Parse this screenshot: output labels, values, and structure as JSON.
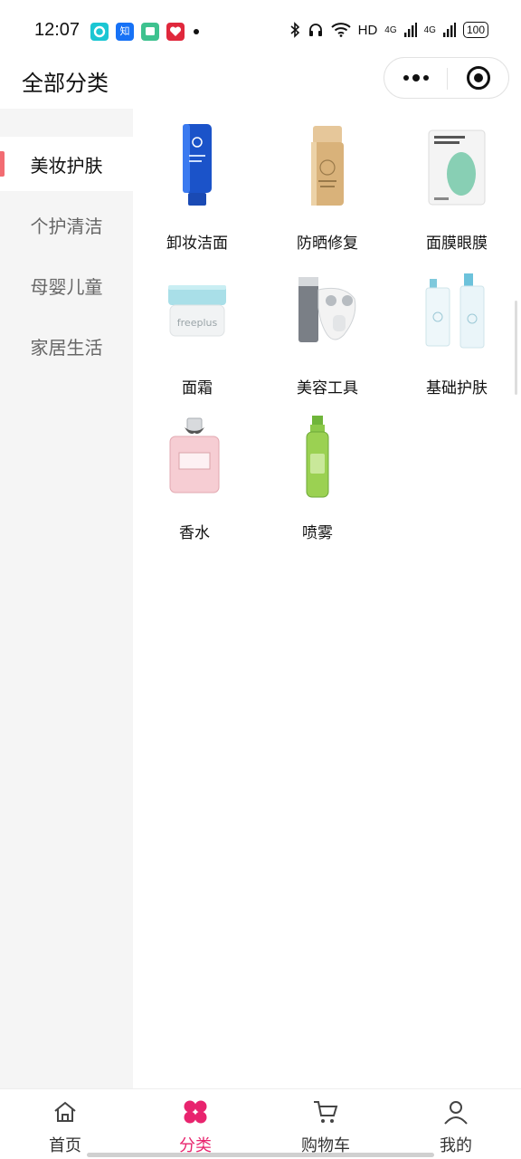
{
  "status_bar": {
    "time": "12:07",
    "network": "HD",
    "signal_1": "4G",
    "signal_2": "4G",
    "battery": "100",
    "notifications": [
      {
        "icon": "app-ring-icon",
        "text": "",
        "color": "#1bc6d3"
      },
      {
        "icon": "zhihu-icon",
        "text": "知",
        "color": "#1772f6"
      },
      {
        "icon": "message-icon",
        "text": "",
        "color": "#3ec28f"
      },
      {
        "icon": "heart-app-icon",
        "text": "",
        "color": "#e0283c"
      }
    ]
  },
  "header": {
    "title": "全部分类"
  },
  "sidebar": {
    "items": [
      {
        "label": "美妆护肤",
        "active": true
      },
      {
        "label": "个护清洁",
        "active": false
      },
      {
        "label": "母婴儿童",
        "active": false
      },
      {
        "label": "家居生活",
        "active": false
      }
    ]
  },
  "categories": [
    {
      "label": "卸妆洁面",
      "icon": "cleanser-tube-icon"
    },
    {
      "label": "防晒修复",
      "icon": "sunscreen-bottle-icon"
    },
    {
      "label": "面膜眼膜",
      "icon": "face-mask-pack-icon"
    },
    {
      "label": "面霜",
      "icon": "cream-jar-icon"
    },
    {
      "label": "美容工具",
      "icon": "beauty-device-icon"
    },
    {
      "label": "基础护肤",
      "icon": "skincare-set-icon"
    },
    {
      "label": "香水",
      "icon": "perfume-bottle-icon"
    },
    {
      "label": "喷雾",
      "icon": "spray-bottle-icon"
    }
  ],
  "tabbar": {
    "tabs": [
      {
        "label": "首页",
        "icon": "home-icon",
        "active": false
      },
      {
        "label": "分类",
        "icon": "category-flower-icon",
        "active": true
      },
      {
        "label": "购物车",
        "icon": "cart-icon",
        "active": false
      },
      {
        "label": "我的",
        "icon": "user-icon",
        "active": false
      }
    ]
  },
  "colors": {
    "accent": "#e8246e",
    "sidebar_active_marker": "#f26c72",
    "sidebar_bg": "#f5f5f5"
  }
}
